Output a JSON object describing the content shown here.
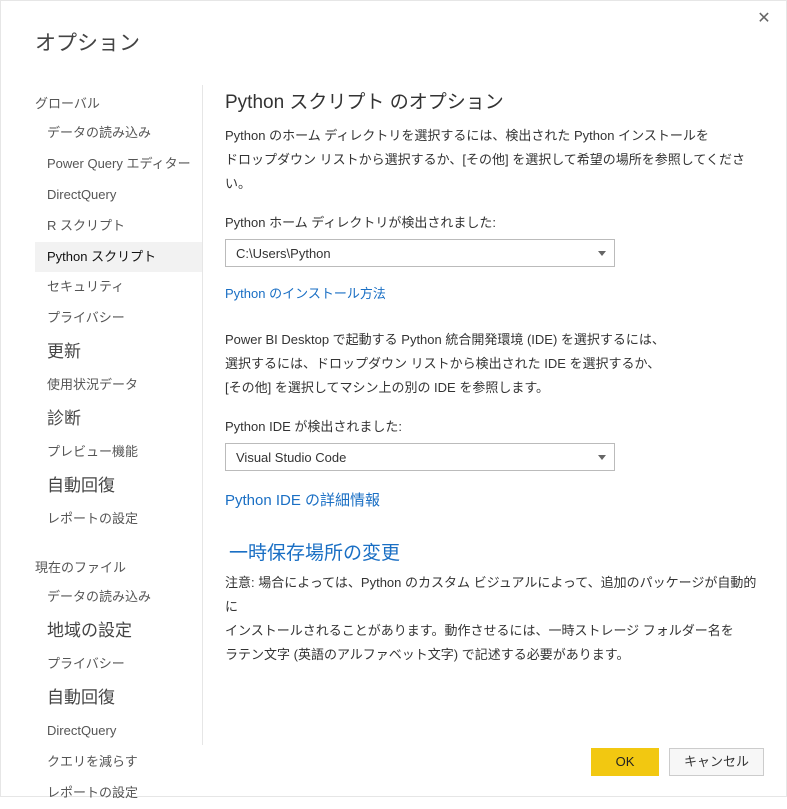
{
  "dialog": {
    "title": "オプション"
  },
  "sidebar": {
    "section1": "グローバル",
    "items1": [
      "データの読み込み",
      "Power Query エディター",
      "DirectQuery",
      "R スクリプト",
      "Python スクリプト",
      "セキュリティ",
      "プライバシー",
      "更新",
      "使用状況データ",
      "診断",
      "プレビュー機能",
      "自動回復",
      "レポートの設定"
    ],
    "section2": "現在のファイル",
    "items2": [
      "データの読み込み",
      "地域の設定",
      "プライバシー",
      "自動回復",
      "DirectQuery",
      "クエリを減らす",
      "レポートの設定"
    ]
  },
  "main": {
    "heading": "Python スクリプト のオプション",
    "desc1": "Python のホーム ディレクトリを選択するには、検出された Python インストールを",
    "desc2": "ドロップダウン リストから選択するか、[その他] を選択して希望の場所を参照してください。",
    "homeLabel": "Python ホーム ディレクトリが検出されました:",
    "homeValue": "C:\\Users\\Python",
    "installLink": "Python のインストール方法",
    "ideDesc1": "Power BI Desktop で起動する Python 統合開発環境 (IDE) を選択するには、",
    "ideDesc2": "選択するには、ドロップダウン リストから検出された IDE を選択するか、",
    "ideDesc3": "[その他] を選択してマシン上の別の IDE を参照します。",
    "ideLabel": "Python IDE が検出されました:",
    "ideValue": "Visual Studio Code",
    "ideLink": "Python IDE の詳細情報",
    "tempHeading": "一時保存場所の変更",
    "tempDesc1": "注意: 場合によっては、Python のカスタム ビジュアルによって、追加のパッケージが自動的に",
    "tempDesc2": "インストールされることがあります。動作させるには、一時ストレージ フォルダー名を",
    "tempDesc3": "ラテン文字 (英語のアルファベット文字) で記述する必要があります。"
  },
  "footer": {
    "ok": "OK",
    "cancel": "キャンセル"
  }
}
